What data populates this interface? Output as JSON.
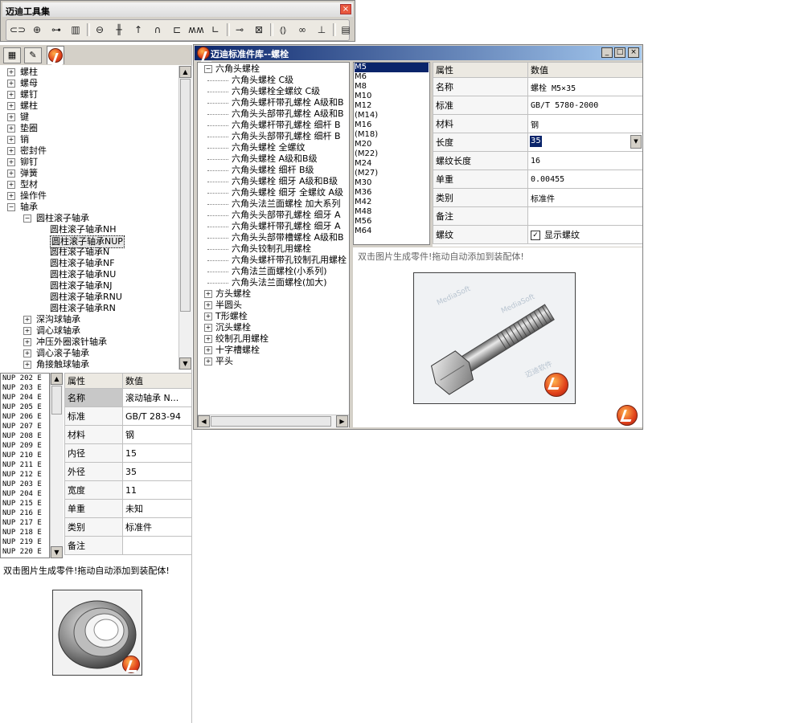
{
  "toolbar_window": {
    "title": "迈迪工具集",
    "close_glyph": "×",
    "tools": [
      {
        "icon": "bolt-icon",
        "glyph": "⊂⊃"
      },
      {
        "icon": "nut-icon",
        "glyph": "⊕"
      },
      {
        "icon": "screw-icon",
        "glyph": "⊶"
      },
      {
        "icon": "stud-icon",
        "glyph": "▥"
      },
      {
        "icon": "key-icon",
        "glyph": "⊖"
      },
      {
        "icon": "pin-icon",
        "glyph": "╫"
      },
      {
        "icon": "rivet-icon",
        "glyph": "↑"
      },
      {
        "icon": "clip-icon",
        "glyph": "∩"
      },
      {
        "icon": "bracket-icon",
        "glyph": "⊏"
      },
      {
        "icon": "spring-icon",
        "glyph": "ʍʍ"
      },
      {
        "icon": "profile-icon",
        "glyph": "∟"
      },
      {
        "icon": "connector-icon",
        "glyph": "⊸"
      },
      {
        "icon": "frame-icon",
        "glyph": "⊠"
      },
      {
        "icon": "bearing-icon",
        "glyph": "⦅⦆"
      },
      {
        "icon": "chain-icon",
        "glyph": "∞"
      },
      {
        "icon": "stand-icon",
        "glyph": "⊥"
      },
      {
        "icon": "book-icon",
        "glyph": "▤"
      }
    ]
  },
  "left_panel": {
    "tree": [
      {
        "label": "螺柱",
        "level": 0,
        "sign": "+"
      },
      {
        "label": "螺母",
        "level": 0,
        "sign": "+"
      },
      {
        "label": "螺钉",
        "level": 0,
        "sign": "+"
      },
      {
        "label": "螺柱",
        "level": 0,
        "sign": "+"
      },
      {
        "label": "键",
        "level": 0,
        "sign": "+"
      },
      {
        "label": "垫圈",
        "level": 0,
        "sign": "+"
      },
      {
        "label": "销",
        "level": 0,
        "sign": "+"
      },
      {
        "label": "密封件",
        "level": 0,
        "sign": "+"
      },
      {
        "label": "铆钉",
        "level": 0,
        "sign": "+"
      },
      {
        "label": "弹簧",
        "level": 0,
        "sign": "+"
      },
      {
        "label": "型材",
        "level": 0,
        "sign": "+"
      },
      {
        "label": "操作件",
        "level": 0,
        "sign": "+"
      },
      {
        "label": "轴承",
        "level": 0,
        "sign": "−"
      },
      {
        "label": "圆柱滚子轴承",
        "level": 1,
        "sign": "−"
      },
      {
        "label": "圆柱滚子轴承NH",
        "level": 2,
        "sign": ""
      },
      {
        "label": "圆柱滚子轴承NUP",
        "level": 2,
        "sign": "",
        "selected": true
      },
      {
        "label": "圆柱滚子轴承N",
        "level": 2,
        "sign": ""
      },
      {
        "label": "圆柱滚子轴承NF",
        "level": 2,
        "sign": ""
      },
      {
        "label": "圆柱滚子轴承NU",
        "level": 2,
        "sign": ""
      },
      {
        "label": "圆柱滚子轴承NJ",
        "level": 2,
        "sign": ""
      },
      {
        "label": "圆柱滚子轴承RNU",
        "level": 2,
        "sign": ""
      },
      {
        "label": "圆柱滚子轴承RN",
        "level": 2,
        "sign": ""
      },
      {
        "label": "深沟球轴承",
        "level": 1,
        "sign": "+"
      },
      {
        "label": "调心球轴承",
        "level": 1,
        "sign": "+"
      },
      {
        "label": "冲压外圈滚针轴承",
        "level": 1,
        "sign": "+"
      },
      {
        "label": "调心滚子轴承",
        "level": 1,
        "sign": "+"
      },
      {
        "label": "角接触球轴承",
        "level": 1,
        "sign": "+"
      }
    ],
    "list": [
      "NUP 202 E",
      "NUP 203 E",
      "NUP 204 E",
      "NUP 205 E",
      "NUP 206 E",
      "NUP 207 E",
      "NUP 208 E",
      "NUP 209 E",
      "NUP 210 E",
      "NUP 211 E",
      "NUP 212 E",
      "NUP 203 E",
      "NUP 204 E",
      "NUP 215 E",
      "NUP 216 E",
      "NUP 217 E",
      "NUP 218 E",
      "NUP 219 E",
      "NUP 220 E"
    ],
    "props_header": {
      "key": "属性",
      "value": "数值"
    },
    "props": [
      {
        "key": "名称",
        "value": "滚动轴承 N..."
      },
      {
        "key": "标准",
        "value": "GB/T 283-94"
      },
      {
        "key": "材料",
        "value": "钢"
      },
      {
        "key": "内径",
        "value": "15"
      },
      {
        "key": "外径",
        "value": "35"
      },
      {
        "key": "宽度",
        "value": "11"
      },
      {
        "key": "单重",
        "value": "未知"
      },
      {
        "key": "类别",
        "value": "标准件"
      },
      {
        "key": "备注",
        "value": ""
      }
    ],
    "hint": "双击图片生成零件!拖动自动添加到装配体!"
  },
  "std_window": {
    "title": "迈迪标准件库--螺栓",
    "min_glyph": "_",
    "max_glyph": "□",
    "close_glyph": "×",
    "tree": [
      {
        "label": "六角头螺栓",
        "level": 0,
        "sign": "−"
      },
      {
        "label": "六角头螺栓 C级",
        "level": 1
      },
      {
        "label": "六角头螺栓全螺纹 C级",
        "level": 1
      },
      {
        "label": "六角头螺杆带孔螺栓 A级和B",
        "level": 1
      },
      {
        "label": "六角头头部带孔螺栓 A级和B",
        "level": 1
      },
      {
        "label": "六角头螺杆带孔螺栓 细杆 B",
        "level": 1
      },
      {
        "label": "六角头头部带孔螺栓 细杆 B",
        "level": 1
      },
      {
        "label": "六角头螺栓 全螺纹",
        "level": 1
      },
      {
        "label": "六角头螺栓 A级和B级",
        "level": 1
      },
      {
        "label": "六角头螺栓 细杆 B级",
        "level": 1
      },
      {
        "label": "六角头螺栓 细牙 A级和B级",
        "level": 1
      },
      {
        "label": "六角头螺栓 细牙 全螺纹 A级",
        "level": 1
      },
      {
        "label": "六角头法兰面螺栓 加大系列",
        "level": 1
      },
      {
        "label": "六角头头部带孔螺栓 细牙 A",
        "level": 1
      },
      {
        "label": "六角头螺杆带孔螺栓 细牙 A",
        "level": 1
      },
      {
        "label": "六角头头部带槽螺栓 A级和B",
        "level": 1
      },
      {
        "label": "六角头铰制孔用螺栓",
        "level": 1
      },
      {
        "label": "六角头螺杆带孔铰制孔用螺栓",
        "level": 1
      },
      {
        "label": "六角法兰面螺栓(小系列)",
        "level": 1
      },
      {
        "label": "六角头法兰面螺栓(加大)",
        "level": 1
      },
      {
        "label": "方头螺栓",
        "level": 0,
        "sign": "+"
      },
      {
        "label": "半圆头",
        "level": 0,
        "sign": "+"
      },
      {
        "label": "T形螺栓",
        "level": 0,
        "sign": "+"
      },
      {
        "label": "沉头螺栓",
        "level": 0,
        "sign": "+"
      },
      {
        "label": "绞制孔用螺栓",
        "level": 0,
        "sign": "+"
      },
      {
        "label": "十字槽螺栓",
        "level": 0,
        "sign": "+"
      },
      {
        "label": "平头",
        "level": 0,
        "sign": "+"
      }
    ],
    "sizes": [
      "M5",
      "M6",
      "M8",
      "M10",
      "M12",
      "(M14)",
      "M16",
      "(M18)",
      "M20",
      "(M22)",
      "M24",
      "(M27)",
      "M30",
      "M36",
      "M42",
      "M48",
      "M56",
      "M64"
    ],
    "props_header": {
      "key": "属性",
      "value": "数值"
    },
    "props": [
      {
        "key": "名称",
        "value": "螺栓 M5×35"
      },
      {
        "key": "标准",
        "value": "GB/T 5780-2000"
      },
      {
        "key": "材料",
        "value": "钢"
      },
      {
        "key": "长度",
        "value": "35"
      },
      {
        "key": "螺纹长度",
        "value": "16"
      },
      {
        "key": "单重",
        "value": "0.00455"
      },
      {
        "key": "类别",
        "value": "标准件"
      },
      {
        "key": "备注",
        "value": ""
      },
      {
        "key": "螺纹",
        "value": "显示螺纹"
      }
    ],
    "checkbox_mark": "✓",
    "hint": "双击图片生成零件!拖动自动添加到装配体!",
    "watermark_brand": "MediaSoft",
    "watermark_cn": "迈迪软件"
  }
}
